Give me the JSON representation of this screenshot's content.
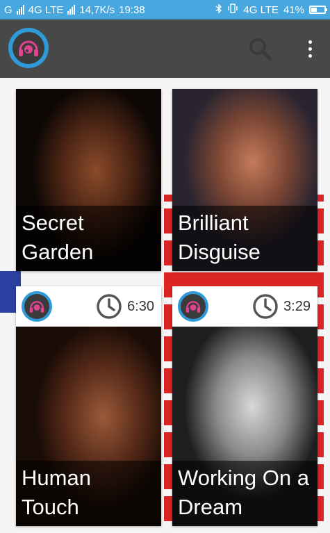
{
  "status_bar": {
    "carrier": "G",
    "network1": "4G LTE",
    "speed": "14,7K/s",
    "time": "19:38",
    "network2": "4G LTE",
    "sim2": "2",
    "battery": "41%",
    "battery_level": 0.41
  },
  "toolbar": {
    "logo": "headphones-logo-icon",
    "search_icon": "search-icon",
    "menu_icon": "more-vert-icon"
  },
  "cards": [
    {
      "title_line1": "Secret",
      "title_line2": "Garden"
    },
    {
      "title_line1": "Brilliant",
      "title_line2": "Disguise"
    },
    {
      "title_line1": "Human",
      "title_line2": "Touch",
      "duration": "6:30"
    },
    {
      "title_line1": "Working On a",
      "title_line2": "Dream",
      "duration": "3:29"
    }
  ],
  "colors": {
    "status_bar": "#49a7df",
    "toolbar": "#484848",
    "logo_ring": "#2f9ad8",
    "logo_accent": "#e0448f"
  }
}
